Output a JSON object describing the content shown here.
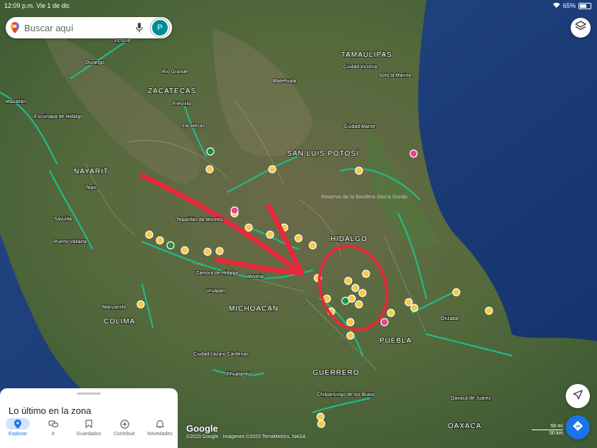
{
  "status_bar": {
    "time": "12:09 p.m.",
    "date": "Vie 1 de dic",
    "battery": "65%"
  },
  "search": {
    "placeholder": "Buscar aquí",
    "avatar_initial": "P"
  },
  "map": {
    "states": [
      "TAMAULIPAS",
      "ZACATECAS",
      "SAN LUIS POTOSÍ",
      "NAYARIT",
      "HIDALGO",
      "MICHOACÁN",
      "COLIMA",
      "PUEBLA",
      "GUERRERO",
      "OAXACA"
    ],
    "cities": [
      "Durango",
      "Victoria",
      "Río Grande",
      "Matehuala",
      "Ciudad Victoria",
      "Soto la Marina",
      "Mazatlán",
      "Escuinapa de Hidalgo",
      "Fresnillo",
      "Zacatecas",
      "Ciudad Mante",
      "Tepic",
      "Sayulita",
      "Puerto Vallarta",
      "Tepatitlán de Morelos",
      "Zamora de Hidalgo",
      "Morelia",
      "Uruapan",
      "Manzanillo",
      "Orizaba",
      "Ciudad Lázaro Cárdenas",
      "Zihuatanejo",
      "Chilpancingo de los Bravo",
      "Oaxaca de Juárez"
    ],
    "areas": [
      "Reserva de la Biosfera Sierra Gorda"
    ],
    "colors": {
      "highway": "#1fbf8f",
      "pin_yellow": "#f7c948",
      "pin_green": "#1e8e3e",
      "pin_pink": "#e8458b",
      "annotation_red": "#e8283a"
    }
  },
  "bottom_sheet": {
    "title": "Lo último en la zona"
  },
  "tabs": [
    {
      "label": "Explorar",
      "icon": "location-pin-icon",
      "active": true
    },
    {
      "label": "Ir",
      "icon": "commute-icon",
      "active": false
    },
    {
      "label": "Guardados",
      "icon": "bookmark-icon",
      "active": false
    },
    {
      "label": "Contribuir",
      "icon": "add-circle-icon",
      "active": false
    },
    {
      "label": "Novedades",
      "icon": "bell-icon",
      "active": false
    }
  ],
  "attribution": {
    "logo": "Google",
    "text": "©2023 Google · Imágenes ©2023 TerraMetrics, NASA"
  },
  "scale": {
    "imperial": "50 mi",
    "metric": "50 km"
  }
}
